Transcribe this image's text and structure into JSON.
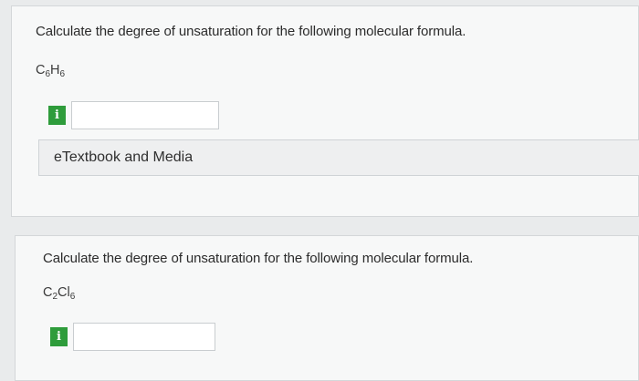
{
  "question1": {
    "prompt": "Calculate the degree of unsaturation for the following molecular formula.",
    "formula": {
      "el1": "C",
      "n1": "6",
      "el2": "H",
      "n2": "6"
    },
    "info_badge": "i",
    "answer_value": ""
  },
  "etextbook": {
    "label": "eTextbook and Media"
  },
  "question2": {
    "prompt": "Calculate the degree of unsaturation for the following molecular formula.",
    "formula": {
      "el1": "C",
      "n1": "2",
      "el2": "Cl",
      "n2": "6"
    },
    "info_badge": "i",
    "answer_value": ""
  },
  "colors": {
    "badge_green": "#2e9c3b",
    "card_background": "#f7f8f8",
    "page_background": "#e9ebec"
  }
}
